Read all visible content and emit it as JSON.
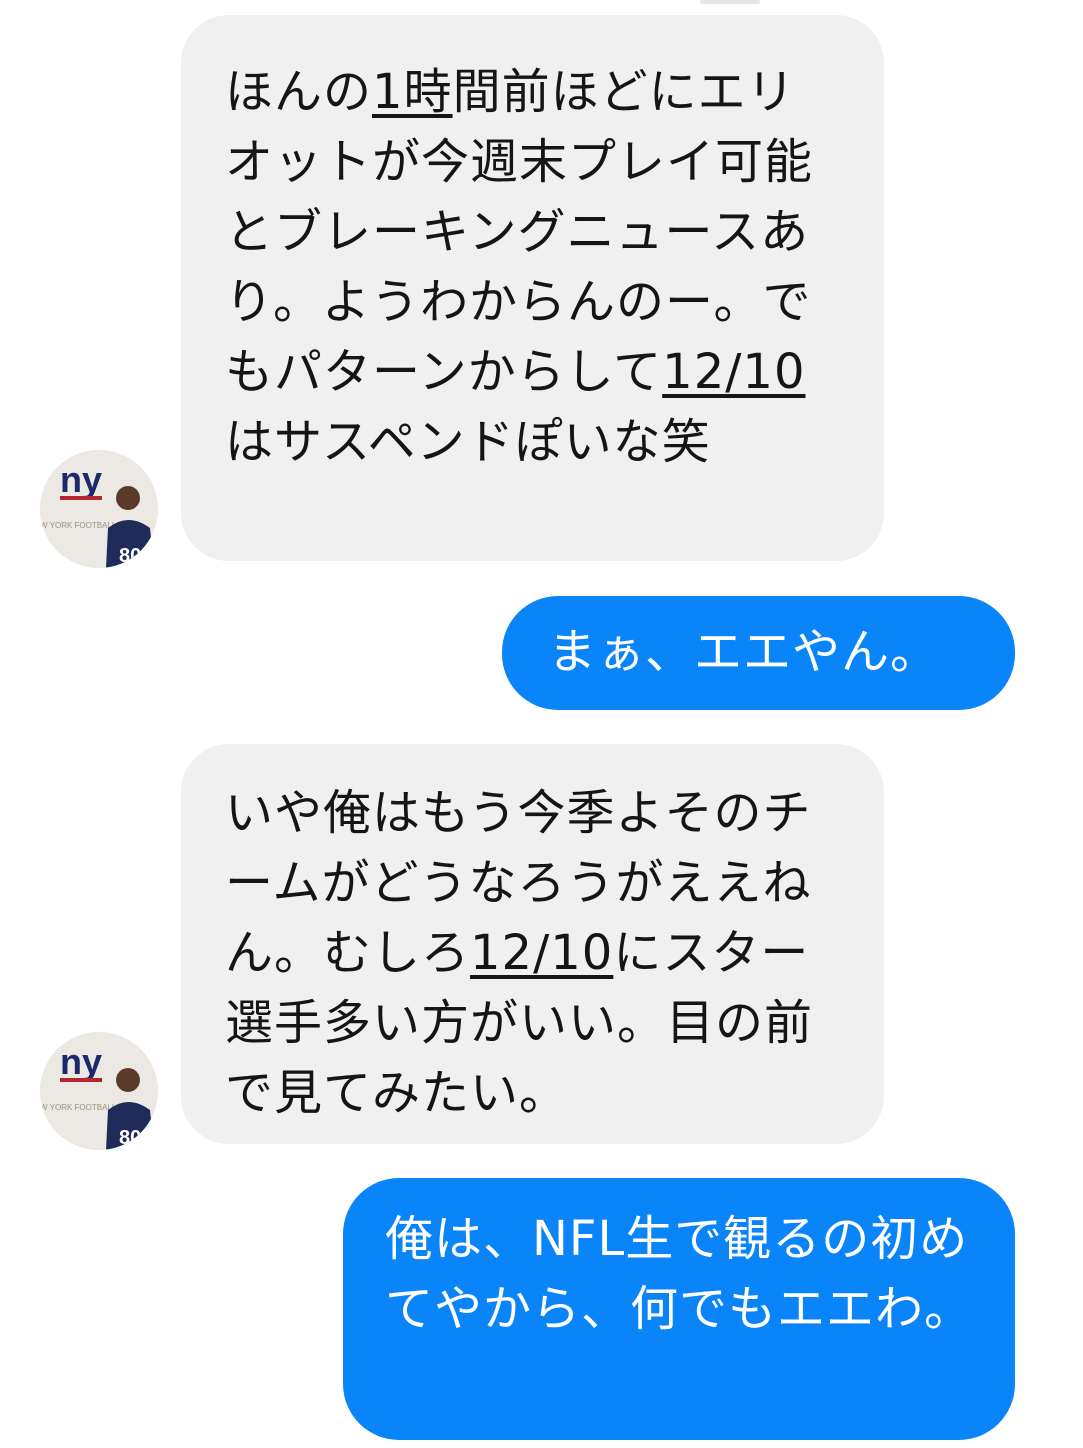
{
  "messages": [
    {
      "side": "incoming",
      "parts": [
        "ほんの",
        "1時",
        "間前ほどにエリオットが今週末プレイ可能とブレーキングニュースあり。ようわからんのー。でもパターンからして",
        "12/10",
        "はサスペンドぽいな笑"
      ]
    },
    {
      "side": "outgoing",
      "text": "まぁ、エエやん。"
    },
    {
      "side": "incoming",
      "parts": [
        "いや俺はもう今季よそのチームがどうなろうがええねん。むしろ",
        "12/10",
        "にスター選手多い方がいい。目の前で見てみたい。"
      ]
    },
    {
      "side": "outgoing",
      "text": "俺は、NFL生で観るの初めてやから、何でもエエわ。"
    }
  ],
  "avatar": {
    "logo_text": "ny",
    "jersey_number": "80",
    "wall_text": "W YORK FOOTBALL",
    "colors": {
      "logo_blue": "#1b2a6b",
      "logo_red": "#b3262f",
      "jersey": "#1f2c5a",
      "wall": "#ece8e3"
    }
  },
  "colors": {
    "incoming_bubble": "#f1f0f0",
    "outgoing_bubble": "#0984f9"
  }
}
